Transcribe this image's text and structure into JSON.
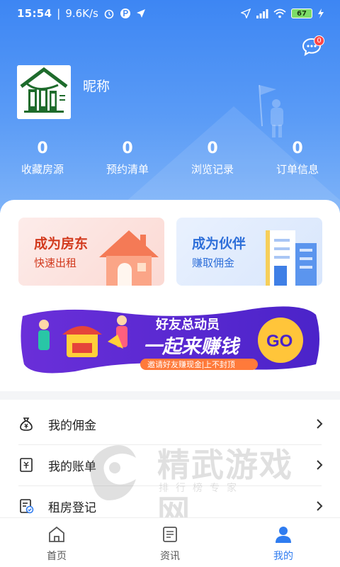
{
  "status_bar": {
    "time": "15:54",
    "net_speed": "9.6K/s",
    "battery": "67"
  },
  "header": {
    "message_badge_count": "0"
  },
  "profile": {
    "nickname": "昵称",
    "avatar_icon": "house-logo-icon"
  },
  "stats": [
    {
      "value": "0",
      "label": "收藏房源"
    },
    {
      "value": "0",
      "label": "预约清单"
    },
    {
      "value": "0",
      "label": "浏览记录"
    },
    {
      "value": "0",
      "label": "订单信息"
    }
  ],
  "cards": {
    "landlord": {
      "title": "成为房东",
      "subtitle": "快速出租"
    },
    "partner": {
      "title": "成为伙伴",
      "subtitle": "赚取佣金"
    }
  },
  "banner": {
    "headline_small": "好友总动员",
    "headline_big": "一起来赚钱",
    "tagline": "邀请好友赚现金|上不封顶",
    "go_label": "GO"
  },
  "menu": [
    {
      "label": "我的佣金",
      "icon": "money-bag-icon"
    },
    {
      "label": "我的账单",
      "icon": "bill-icon"
    },
    {
      "label": "租房登记",
      "icon": "register-icon"
    }
  ],
  "watermark": {
    "text": "精武游戏网",
    "sub": "排行榜专家"
  },
  "tabbar": {
    "items": [
      {
        "label": "首页",
        "icon": "home-icon"
      },
      {
        "label": "资讯",
        "icon": "news-icon"
      },
      {
        "label": "我的",
        "icon": "user-icon"
      }
    ],
    "active_index": 2
  },
  "colors": {
    "primary": "#2f7cf0",
    "hero_top": "#3d86f3",
    "landlord_accent": "#d23a1e",
    "partner_accent": "#2e6fd9",
    "banner_purple": "#5a2bd6",
    "go_yellow": "#ffc53a"
  }
}
